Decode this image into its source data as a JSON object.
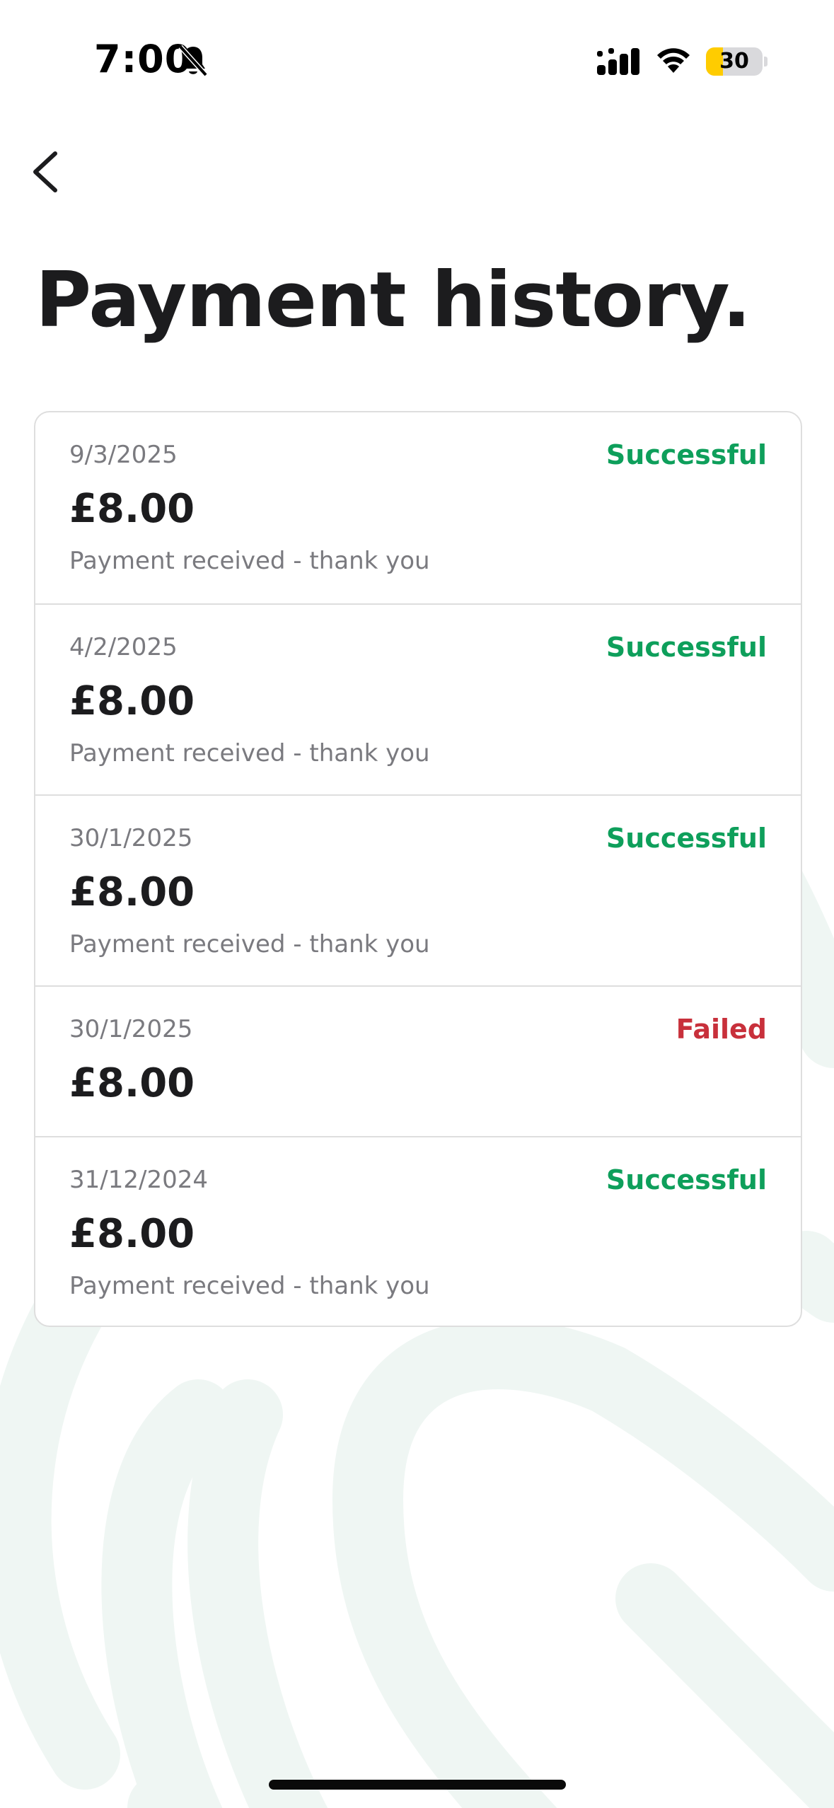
{
  "status_bar": {
    "time": "7:00",
    "battery_level": "30",
    "battery_fraction": 0.3,
    "battery_color": "#ffcc00"
  },
  "header": {
    "back_icon": "chevron-left-icon",
    "title": "Payment history."
  },
  "colors": {
    "success": "#0e9f5b",
    "failed": "#c8303b",
    "background_pattern": "#eff6f3"
  },
  "payments": [
    {
      "date": "9/3/2025",
      "amount": "£8.00",
      "status": "Successful",
      "note": "Payment received - thank you"
    },
    {
      "date": "4/2/2025",
      "amount": "£8.00",
      "status": "Successful",
      "note": "Payment received - thank you"
    },
    {
      "date": "30/1/2025",
      "amount": "£8.00",
      "status": "Successful",
      "note": "Payment received - thank you"
    },
    {
      "date": "30/1/2025",
      "amount": "£8.00",
      "status": "Failed",
      "note": ""
    },
    {
      "date": "31/12/2024",
      "amount": "£8.00",
      "status": "Successful",
      "note": "Payment received - thank you"
    }
  ]
}
